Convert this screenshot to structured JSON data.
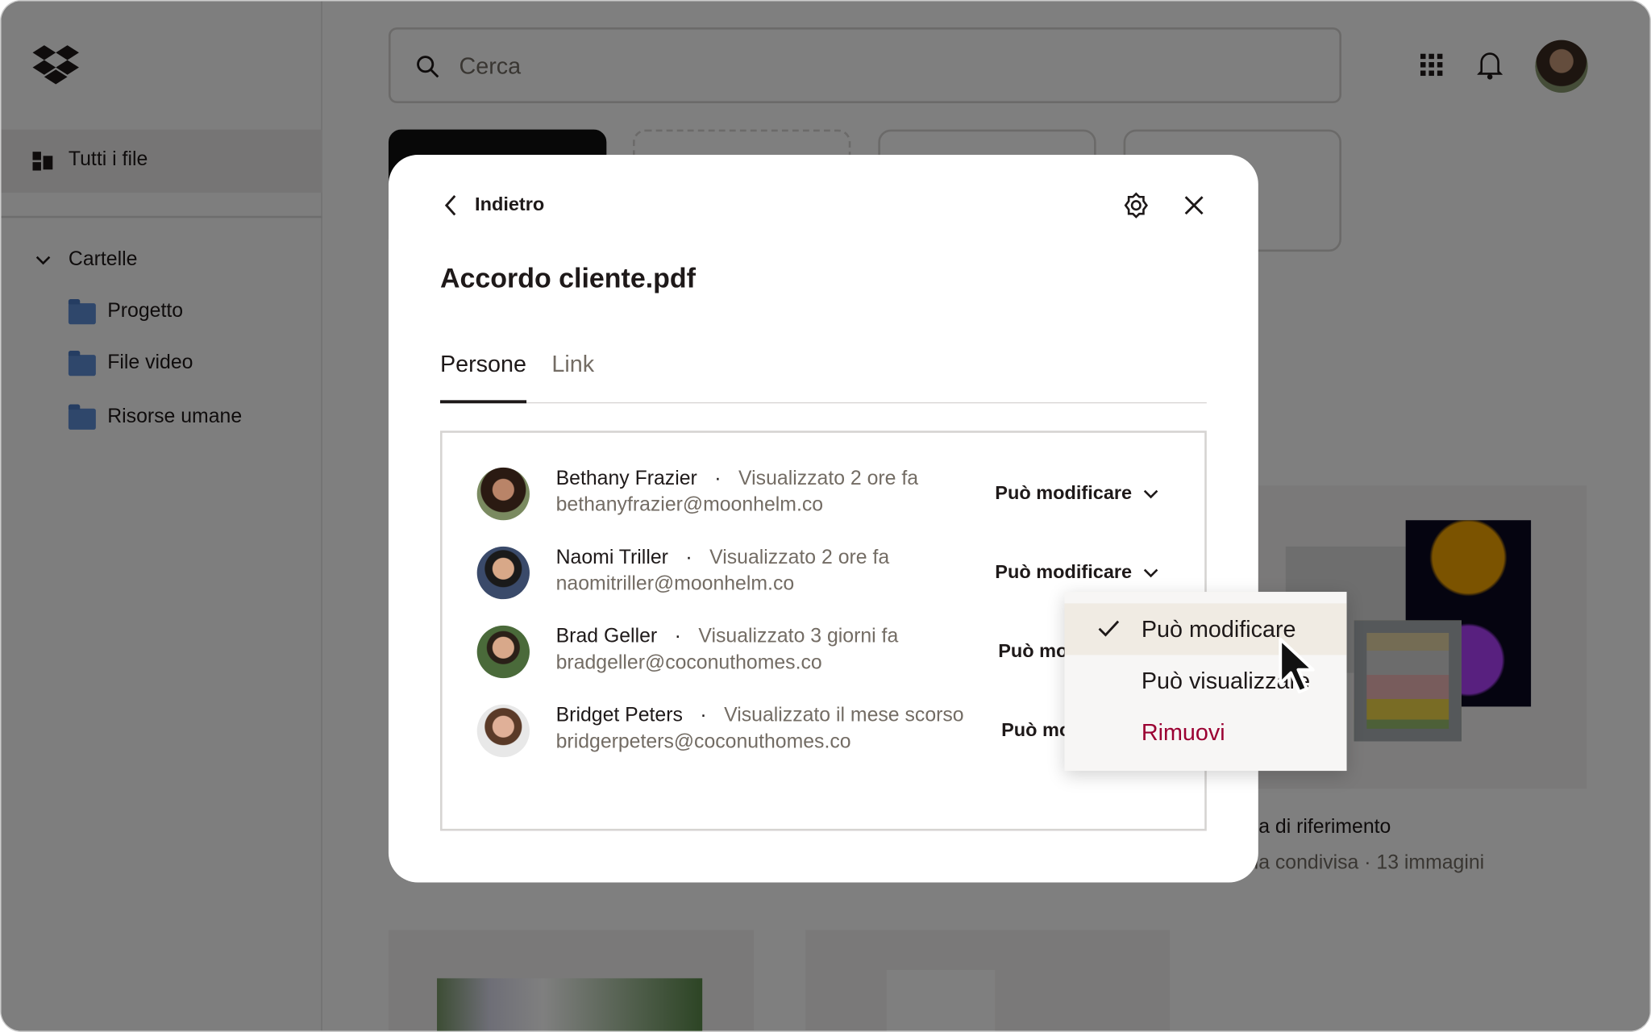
{
  "sidebar": {
    "all_files": "Tutti i file",
    "folders_header": "Cartelle",
    "folders": [
      "Progetto",
      "File video",
      "Risorse umane"
    ]
  },
  "header": {
    "search_placeholder": "Cerca"
  },
  "background": {
    "folder_card_title": "tella di riferimento",
    "folder_card_subtitle": "tella condivisa · 13 immagini"
  },
  "modal": {
    "back_label": "Indietro",
    "title": "Accordo cliente.pdf",
    "tabs": [
      {
        "label": "Persone",
        "active": true
      },
      {
        "label": "Link",
        "active": false
      }
    ],
    "people": [
      {
        "name": "Bethany Frazier",
        "separator": "·",
        "status": "Visualizzato 2 ore fa",
        "email": "bethanyfrazier@moonhelm.co",
        "permission": "Può modificare"
      },
      {
        "name": "Naomi Triller",
        "separator": "·",
        "status": "Visualizzato 2 ore fa",
        "email": "naomitriller@moonhelm.co",
        "permission": "Può modificare"
      },
      {
        "name": "Brad Geller",
        "separator": "·",
        "status": "Visualizzato 3 giorni fa",
        "email": "bradgeller@coconuthomes.co",
        "permission": "Può modificare"
      },
      {
        "name": "Bridget Peters",
        "separator": "·",
        "status": "Visualizzato il mese scorso",
        "email": "bridgerpeters@coconuthomes.co",
        "permission": "Può modificare"
      }
    ]
  },
  "dropdown": {
    "items": [
      {
        "label": "Può modificare",
        "selected": true
      },
      {
        "label": "Può visualizzare",
        "selected": false
      },
      {
        "label": "Rimuovi",
        "selected": false
      }
    ],
    "danger_color": "#9b0032",
    "selected_bg": "#f0ebe3"
  }
}
